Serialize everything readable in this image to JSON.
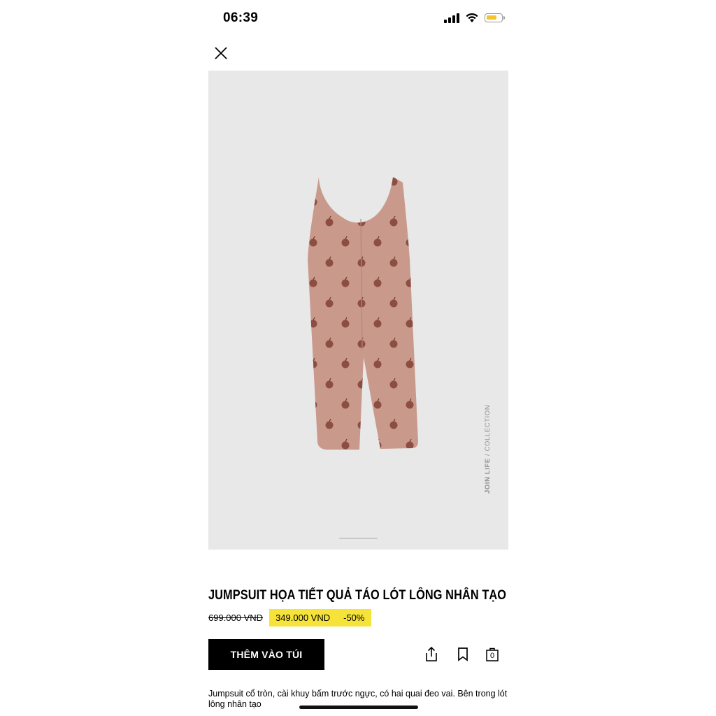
{
  "status_bar": {
    "time": "06:39",
    "icons": [
      "signal-icon",
      "wifi-icon",
      "battery-icon"
    ],
    "battery_color": "#f4c430"
  },
  "header": {
    "close_icon": "close-icon"
  },
  "product_image": {
    "side_label_bold": "JOIN LIFE",
    "side_label_rest": " / COLLECTION",
    "background": "#e8e8e8",
    "garment_color": "#c99a8c",
    "print_color": "#8a4a3e"
  },
  "product": {
    "title": "JUMPSUIT HỌA TIẾT QUẢ TÁO LÓT LÔNG NHÂN TẠO",
    "old_price": "699.000 VND",
    "sale_price": "349.000 VND",
    "discount": "-50%",
    "sale_highlight_color": "#f5e33a"
  },
  "actions": {
    "add_to_bag_label": "THÊM VÀO TÚI",
    "share_icon": "share-icon",
    "bookmark_icon": "bookmark-icon",
    "bag_icon": "shopping-bag-icon",
    "bag_count": "0"
  },
  "description": {
    "text": "Jumpsuit cổ tròn, cài khuy bấm trước ngực, có hai quai đeo vai. Bên trong lót lông nhân tạo"
  }
}
